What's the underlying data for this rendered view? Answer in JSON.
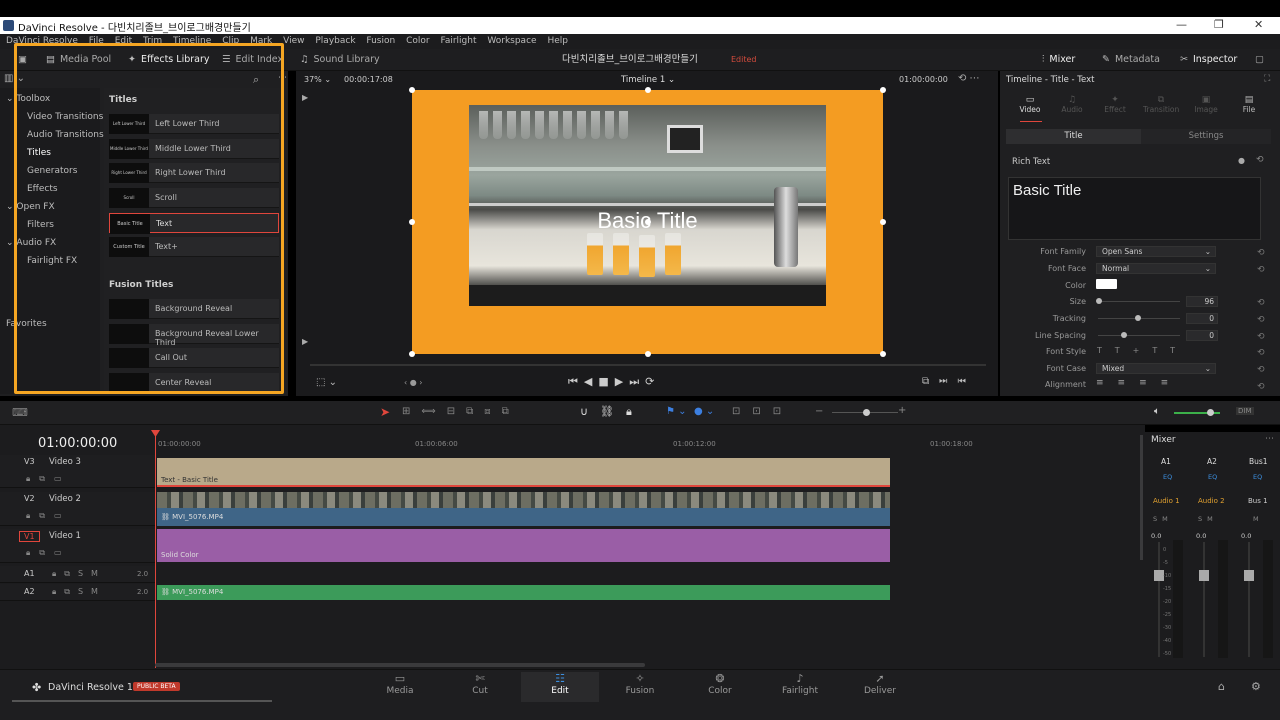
{
  "window": {
    "title": "DaVinci Resolve - 다빈치리졸브_브이로그배경만들기"
  },
  "menu": [
    "DaVinci Resolve",
    "File",
    "Edit",
    "Trim",
    "Timeline",
    "Clip",
    "Mark",
    "View",
    "Playback",
    "Fusion",
    "Color",
    "Fairlight",
    "Workspace",
    "Help"
  ],
  "toolbar": {
    "media_pool": "Media Pool",
    "effects_library": "Effects Library",
    "edit_index": "Edit Index",
    "sound_library": "Sound Library",
    "project_name": "다빈치리졸브_브이로그배경만들기",
    "edited": "Edited",
    "mixer": "Mixer",
    "metadata": "Metadata",
    "inspector": "Inspector"
  },
  "toolbox": {
    "items": [
      "Toolbox",
      "Video Transitions",
      "Audio Transitions",
      "Titles",
      "Generators",
      "Effects",
      "Open FX",
      "Filters",
      "Audio FX",
      "Fairlight FX"
    ],
    "favorites": "Favorites"
  },
  "effects": {
    "titles_header": "Titles",
    "titles": [
      {
        "thumb": "Left Lower Third",
        "name": "Left Lower Third"
      },
      {
        "thumb": "Middle Lower Third",
        "name": "Middle Lower Third"
      },
      {
        "thumb": "Right Lower Third",
        "name": "Right Lower Third"
      },
      {
        "thumb": "Scroll",
        "name": "Scroll"
      },
      {
        "thumb": "Basic Title",
        "name": "Text"
      },
      {
        "thumb": "Custom Title",
        "name": "Text+"
      }
    ],
    "fusion_header": "Fusion Titles",
    "fusion_titles": [
      {
        "name": "Background Reveal"
      },
      {
        "name": "Background Reveal Lower Third"
      },
      {
        "name": "Call Out"
      },
      {
        "name": "Center Reveal"
      }
    ]
  },
  "viewer": {
    "zoom": "37%",
    "timecode_left": "00:00:17:08",
    "timeline_name": "Timeline 1",
    "timecode_right": "01:00:00:00",
    "overlay_title": "Basic Title"
  },
  "inspector": {
    "header": "Timeline - Title - Text",
    "tabs": [
      "Video",
      "Audio",
      "Effect",
      "Transition",
      "Image",
      "File"
    ],
    "subtabs": [
      "Title",
      "Settings"
    ],
    "rich_text_label": "Rich Text",
    "rich_text_value": "Basic Title",
    "font_family_label": "Font Family",
    "font_family": "Open Sans",
    "font_face_label": "Font Face",
    "font_face": "Normal",
    "color_label": "Color",
    "size_label": "Size",
    "size": "96",
    "tracking_label": "Tracking",
    "tracking": "0",
    "line_spacing_label": "Line Spacing",
    "line_spacing": "0",
    "font_style_label": "Font Style",
    "font_case_label": "Font Case",
    "font_case": "Mixed",
    "alignment_label": "Alignment"
  },
  "timeline": {
    "timecode": "01:00:00:00",
    "ruler": [
      "01:00:00:00",
      "01:00:06:00",
      "01:00:12:00",
      "01:00:18:00"
    ],
    "tracks": [
      {
        "id": "V3",
        "name": "Video 3"
      },
      {
        "id": "V2",
        "name": "Video 2"
      },
      {
        "id": "V1",
        "name": "Video 1"
      },
      {
        "id": "A1",
        "vol": "2.0"
      },
      {
        "id": "A2",
        "vol": "2.0"
      }
    ],
    "clips": {
      "v3": "Text - Basic Title",
      "v2": "MVI_5076.MP4",
      "v1": "Solid Color",
      "a2": "MVI_5076.MP4"
    }
  },
  "mixer": {
    "title": "Mixer",
    "channels": [
      "A1",
      "A2",
      "Bus1"
    ],
    "eq": "EQ",
    "names": [
      "Audio 1",
      "Audio 2",
      "Bus 1"
    ],
    "level": "0.0",
    "scale": [
      "0",
      "-5",
      "-10",
      "-15",
      "-20",
      "-25",
      "-30",
      "-40",
      "-50"
    ]
  },
  "bottom": {
    "app": "DaVinci Resolve 17",
    "beta": "PUBLIC BETA",
    "pages": [
      "Media",
      "Cut",
      "Edit",
      "Fusion",
      "Color",
      "Fairlight",
      "Deliver"
    ]
  }
}
